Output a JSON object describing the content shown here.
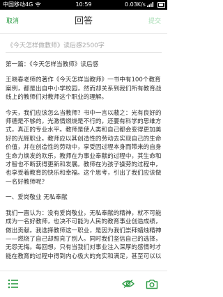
{
  "status_bar": {
    "carrier": "中国移动4G",
    "time": "10:59",
    "network_speed": "0.03K/s"
  },
  "nav": {
    "cancel_label": "取消",
    "title": "回答",
    "submit_label": "提交"
  },
  "document": {
    "title": "《今天怎样做教师》读后感2500字",
    "paragraphs": [
      "第一篇：《今天怎样当教师》读后感",
      "王晓春老师的著作《今天怎样当教师》一书中有100个教育案例，都是出自中小学校园，然而却关系到我们所有教育战线上的教师们对教师这个职业的理解。",
      "今天，我们应该怎么当教师？书中一言以蔽之：光有良好的师德是不够的，光激情燃烧是不行的，还要有科学的思维方式，真正的专业水平。教师是使人类和自己都会变得更加美好的光辉职业。教师应以其创造性的劳动去实现自己的生命价值，并在创造性的劳动中，享受因过程本身而带来的自身生命力焕发的欢乐，教师在为事业奉献的过程中，其生命和才智也不断获得更新和发展。教师在为孩子操劳的过程中，也享受着教育的快乐和幸福。这个思考，引出了我们应该做一名好教师呢？",
      "一、爱岗敬业 无私奉献",
      "我们一直认为：没有爱岗敬业，无私奉献的精神，就不可能成为一名好教师，也决不可能为人民的教育事业创造成绩，做出贡献。我选择教师这一职业，是因为我们崇拜蜡烛精神——燃烧了自己却照亮了别人。同时我们坚信自己的选择，无怨无悔。每回想，只有当我们对事业注入深厚的感情时才能在教育的过程中得到内心极大的充实和满足，甚至可以以苦为乐，以苦为趣，达到物我两忘，醉迷其中的“孔颜之乐”的境地。做一名教师既然选择了这个职业，就应该全身心地投入，忠诚于党的教育事业，爱岗敬业，无私奉献。"
    ]
  },
  "bottom_bar": {
    "icons": [
      "list-icon",
      "eye-icon",
      "camera-icon"
    ],
    "accent_color": "#2e9d46"
  }
}
